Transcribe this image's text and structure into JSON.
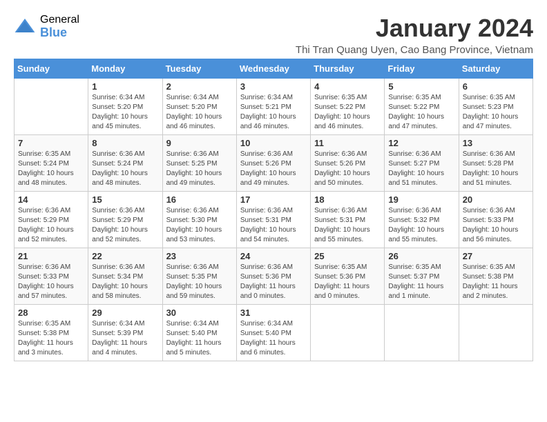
{
  "header": {
    "logo_general": "General",
    "logo_blue": "Blue",
    "title": "January 2024",
    "subtitle": "Thi Tran Quang Uyen, Cao Bang Province, Vietnam"
  },
  "days_of_week": [
    "Sunday",
    "Monday",
    "Tuesday",
    "Wednesday",
    "Thursday",
    "Friday",
    "Saturday"
  ],
  "weeks": [
    [
      {
        "day": "",
        "info": ""
      },
      {
        "day": "1",
        "info": "Sunrise: 6:34 AM\nSunset: 5:20 PM\nDaylight: 10 hours\nand 45 minutes."
      },
      {
        "day": "2",
        "info": "Sunrise: 6:34 AM\nSunset: 5:20 PM\nDaylight: 10 hours\nand 46 minutes."
      },
      {
        "day": "3",
        "info": "Sunrise: 6:34 AM\nSunset: 5:21 PM\nDaylight: 10 hours\nand 46 minutes."
      },
      {
        "day": "4",
        "info": "Sunrise: 6:35 AM\nSunset: 5:22 PM\nDaylight: 10 hours\nand 46 minutes."
      },
      {
        "day": "5",
        "info": "Sunrise: 6:35 AM\nSunset: 5:22 PM\nDaylight: 10 hours\nand 47 minutes."
      },
      {
        "day": "6",
        "info": "Sunrise: 6:35 AM\nSunset: 5:23 PM\nDaylight: 10 hours\nand 47 minutes."
      }
    ],
    [
      {
        "day": "7",
        "info": "Sunrise: 6:35 AM\nSunset: 5:24 PM\nDaylight: 10 hours\nand 48 minutes."
      },
      {
        "day": "8",
        "info": "Sunrise: 6:36 AM\nSunset: 5:24 PM\nDaylight: 10 hours\nand 48 minutes."
      },
      {
        "day": "9",
        "info": "Sunrise: 6:36 AM\nSunset: 5:25 PM\nDaylight: 10 hours\nand 49 minutes."
      },
      {
        "day": "10",
        "info": "Sunrise: 6:36 AM\nSunset: 5:26 PM\nDaylight: 10 hours\nand 49 minutes."
      },
      {
        "day": "11",
        "info": "Sunrise: 6:36 AM\nSunset: 5:26 PM\nDaylight: 10 hours\nand 50 minutes."
      },
      {
        "day": "12",
        "info": "Sunrise: 6:36 AM\nSunset: 5:27 PM\nDaylight: 10 hours\nand 51 minutes."
      },
      {
        "day": "13",
        "info": "Sunrise: 6:36 AM\nSunset: 5:28 PM\nDaylight: 10 hours\nand 51 minutes."
      }
    ],
    [
      {
        "day": "14",
        "info": "Sunrise: 6:36 AM\nSunset: 5:29 PM\nDaylight: 10 hours\nand 52 minutes."
      },
      {
        "day": "15",
        "info": "Sunrise: 6:36 AM\nSunset: 5:29 PM\nDaylight: 10 hours\nand 52 minutes."
      },
      {
        "day": "16",
        "info": "Sunrise: 6:36 AM\nSunset: 5:30 PM\nDaylight: 10 hours\nand 53 minutes."
      },
      {
        "day": "17",
        "info": "Sunrise: 6:36 AM\nSunset: 5:31 PM\nDaylight: 10 hours\nand 54 minutes."
      },
      {
        "day": "18",
        "info": "Sunrise: 6:36 AM\nSunset: 5:31 PM\nDaylight: 10 hours\nand 55 minutes."
      },
      {
        "day": "19",
        "info": "Sunrise: 6:36 AM\nSunset: 5:32 PM\nDaylight: 10 hours\nand 55 minutes."
      },
      {
        "day": "20",
        "info": "Sunrise: 6:36 AM\nSunset: 5:33 PM\nDaylight: 10 hours\nand 56 minutes."
      }
    ],
    [
      {
        "day": "21",
        "info": "Sunrise: 6:36 AM\nSunset: 5:33 PM\nDaylight: 10 hours\nand 57 minutes."
      },
      {
        "day": "22",
        "info": "Sunrise: 6:36 AM\nSunset: 5:34 PM\nDaylight: 10 hours\nand 58 minutes."
      },
      {
        "day": "23",
        "info": "Sunrise: 6:36 AM\nSunset: 5:35 PM\nDaylight: 10 hours\nand 59 minutes."
      },
      {
        "day": "24",
        "info": "Sunrise: 6:36 AM\nSunset: 5:36 PM\nDaylight: 11 hours\nand 0 minutes."
      },
      {
        "day": "25",
        "info": "Sunrise: 6:35 AM\nSunset: 5:36 PM\nDaylight: 11 hours\nand 0 minutes."
      },
      {
        "day": "26",
        "info": "Sunrise: 6:35 AM\nSunset: 5:37 PM\nDaylight: 11 hours\nand 1 minute."
      },
      {
        "day": "27",
        "info": "Sunrise: 6:35 AM\nSunset: 5:38 PM\nDaylight: 11 hours\nand 2 minutes."
      }
    ],
    [
      {
        "day": "28",
        "info": "Sunrise: 6:35 AM\nSunset: 5:38 PM\nDaylight: 11 hours\nand 3 minutes."
      },
      {
        "day": "29",
        "info": "Sunrise: 6:34 AM\nSunset: 5:39 PM\nDaylight: 11 hours\nand 4 minutes."
      },
      {
        "day": "30",
        "info": "Sunrise: 6:34 AM\nSunset: 5:40 PM\nDaylight: 11 hours\nand 5 minutes."
      },
      {
        "day": "31",
        "info": "Sunrise: 6:34 AM\nSunset: 5:40 PM\nDaylight: 11 hours\nand 6 minutes."
      },
      {
        "day": "",
        "info": ""
      },
      {
        "day": "",
        "info": ""
      },
      {
        "day": "",
        "info": ""
      }
    ]
  ]
}
